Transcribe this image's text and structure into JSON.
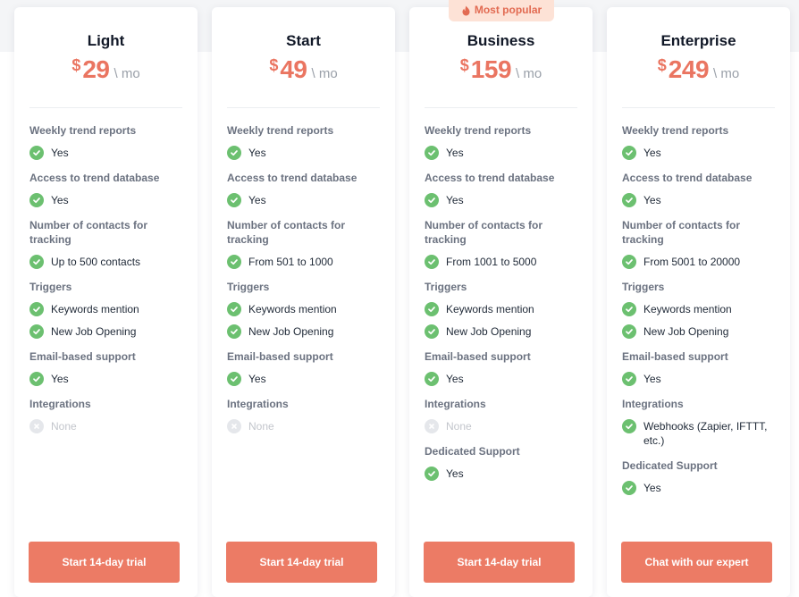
{
  "badge": {
    "label": "Most popular"
  },
  "plans": [
    {
      "name": "Light",
      "currency": "$",
      "price": "29",
      "period": "\\ mo",
      "cta": "Start 14-day trial",
      "features": [
        {
          "title": "Weekly trend reports",
          "items": [
            {
              "text": "Yes",
              "included": true
            }
          ]
        },
        {
          "title": "Access to trend database",
          "items": [
            {
              "text": "Yes",
              "included": true
            }
          ]
        },
        {
          "title": "Number of contacts for tracking",
          "items": [
            {
              "text": "Up to 500 contacts",
              "included": true
            }
          ]
        },
        {
          "title": "Triggers",
          "items": [
            {
              "text": "Keywords mention",
              "included": true
            },
            {
              "text": "New Job Opening",
              "included": true
            }
          ]
        },
        {
          "title": "Email-based support",
          "items": [
            {
              "text": "Yes",
              "included": true
            }
          ]
        },
        {
          "title": "Integrations",
          "items": [
            {
              "text": "None",
              "included": false
            }
          ]
        }
      ]
    },
    {
      "name": "Start",
      "currency": "$",
      "price": "49",
      "period": "\\ mo",
      "cta": "Start 14-day trial",
      "features": [
        {
          "title": "Weekly trend reports",
          "items": [
            {
              "text": "Yes",
              "included": true
            }
          ]
        },
        {
          "title": "Access to trend database",
          "items": [
            {
              "text": "Yes",
              "included": true
            }
          ]
        },
        {
          "title": "Number of contacts for tracking",
          "items": [
            {
              "text": "From 501 to 1000",
              "included": true
            }
          ]
        },
        {
          "title": "Triggers",
          "items": [
            {
              "text": "Keywords mention",
              "included": true
            },
            {
              "text": "New Job Opening",
              "included": true
            }
          ]
        },
        {
          "title": "Email-based support",
          "items": [
            {
              "text": "Yes",
              "included": true
            }
          ]
        },
        {
          "title": "Integrations",
          "items": [
            {
              "text": "None",
              "included": false
            }
          ]
        }
      ]
    },
    {
      "name": "Business",
      "currency": "$",
      "price": "159",
      "period": "\\ mo",
      "cta": "Start 14-day trial",
      "popular": true,
      "features": [
        {
          "title": "Weekly trend reports",
          "items": [
            {
              "text": "Yes",
              "included": true
            }
          ]
        },
        {
          "title": "Access to trend database",
          "items": [
            {
              "text": "Yes",
              "included": true
            }
          ]
        },
        {
          "title": "Number of contacts for tracking",
          "items": [
            {
              "text": "From 1001 to 5000",
              "included": true
            }
          ]
        },
        {
          "title": "Triggers",
          "items": [
            {
              "text": "Keywords mention",
              "included": true
            },
            {
              "text": "New Job Opening",
              "included": true
            }
          ]
        },
        {
          "title": "Email-based support",
          "items": [
            {
              "text": "Yes",
              "included": true
            }
          ]
        },
        {
          "title": "Integrations",
          "items": [
            {
              "text": "None",
              "included": false
            }
          ]
        },
        {
          "title": "Dedicated Support",
          "items": [
            {
              "text": "Yes",
              "included": true
            }
          ]
        }
      ]
    },
    {
      "name": "Enterprise",
      "currency": "$",
      "price": "249",
      "period": "\\ mo",
      "cta": "Chat with our expert",
      "features": [
        {
          "title": "Weekly trend reports",
          "items": [
            {
              "text": "Yes",
              "included": true
            }
          ]
        },
        {
          "title": "Access to trend database",
          "items": [
            {
              "text": "Yes",
              "included": true
            }
          ]
        },
        {
          "title": "Number of contacts for tracking",
          "items": [
            {
              "text": "From 5001 to 20000",
              "included": true
            }
          ]
        },
        {
          "title": "Triggers",
          "items": [
            {
              "text": "Keywords mention",
              "included": true
            },
            {
              "text": "New Job Opening",
              "included": true
            }
          ]
        },
        {
          "title": "Email-based support",
          "items": [
            {
              "text": "Yes",
              "included": true
            }
          ]
        },
        {
          "title": "Integrations",
          "items": [
            {
              "text": "Webhooks (Zapier, IFTTT, etc.)",
              "included": true
            }
          ]
        },
        {
          "title": "Dedicated Support",
          "items": [
            {
              "text": "Yes",
              "included": true
            }
          ]
        }
      ]
    }
  ],
  "colors": {
    "accent": "#ec7b65",
    "check": "#6cc070",
    "badge_bg": "#fde2d6"
  },
  "icons": {
    "included": "check-circle-icon",
    "excluded": "x-circle-icon",
    "badge": "flame-icon"
  }
}
